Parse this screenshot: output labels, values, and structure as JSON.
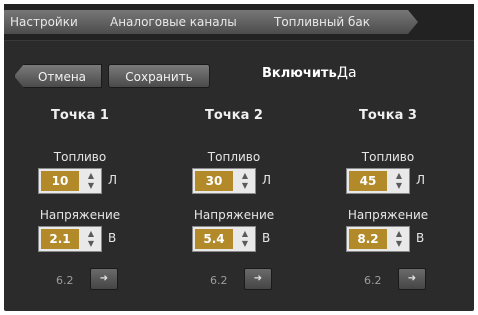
{
  "breadcrumb": [
    "Настройки",
    "Аналоговые каналы",
    "Топливный бак"
  ],
  "toolbar": {
    "cancel_label": "Отмена",
    "save_label": "Сохранить",
    "enable_label": "Включить",
    "enable_value": "Да"
  },
  "points": [
    {
      "title": "Точка 1",
      "fuel_label": "Топливо",
      "fuel_value": "10",
      "fuel_unit": "Л",
      "voltage_label": "Напряжение",
      "voltage_value": "2.1",
      "voltage_unit": "В",
      "ratio": "6.2",
      "action_icon": "arrow-icon"
    },
    {
      "title": "Точка 2",
      "fuel_label": "Топливо",
      "fuel_value": "30",
      "fuel_unit": "Л",
      "voltage_label": "Напряжение",
      "voltage_value": "5.4",
      "voltage_unit": "В",
      "ratio": "6.2",
      "action_icon": "arrow-icon"
    },
    {
      "title": "Точка 3",
      "fuel_label": "Топливо",
      "fuel_value": "45",
      "fuel_unit": "Л",
      "voltage_label": "Напряжение",
      "voltage_value": "8.2",
      "voltage_unit": "В",
      "ratio": "6.2",
      "action_icon": "arrow-icon"
    }
  ],
  "colors": {
    "background": "#2b2b2b",
    "value_highlight": "#b28a2a",
    "text": "#f0f0f0"
  }
}
